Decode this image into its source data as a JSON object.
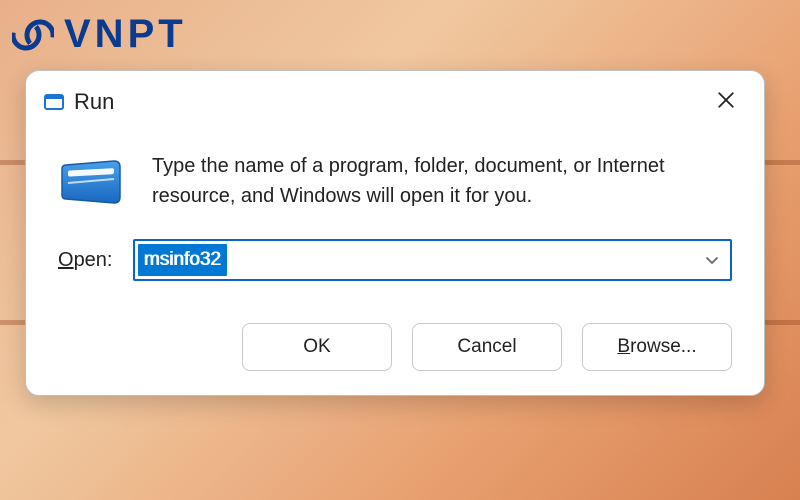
{
  "logo": {
    "text": "VNPT"
  },
  "dialog": {
    "title": "Run",
    "description": "Type the name of a program, folder, document, or Internet resource, and Windows will open it for you.",
    "open_label_ul": "O",
    "open_label_rest": "pen:",
    "input_value": "msinfo32",
    "buttons": {
      "ok": "OK",
      "cancel": "Cancel",
      "browse_ul": "B",
      "browse_rest": "rowse..."
    }
  }
}
